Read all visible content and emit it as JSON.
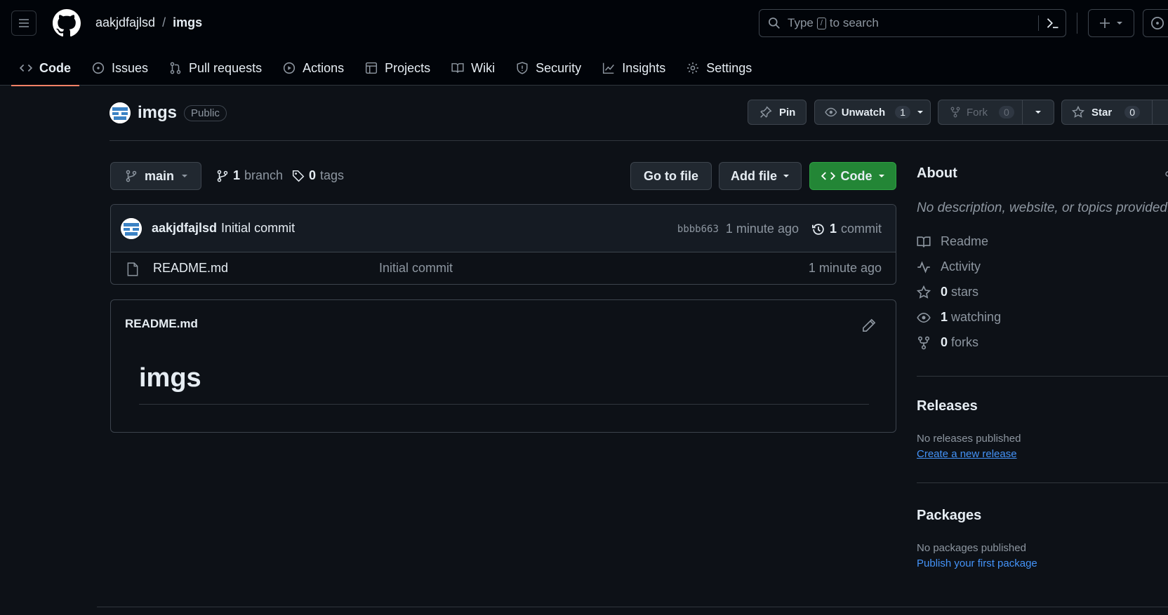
{
  "header": {
    "owner": "aakjdfajlsd",
    "separator": "/",
    "repo": "imgs",
    "search_prefix": "Type",
    "search_key": "/",
    "search_suffix": "to search"
  },
  "nav": {
    "code": "Code",
    "issues": "Issues",
    "pulls": "Pull requests",
    "actions": "Actions",
    "projects": "Projects",
    "wiki": "Wiki",
    "security": "Security",
    "insights": "Insights",
    "settings": "Settings"
  },
  "repo": {
    "name": "imgs",
    "visibility": "Public",
    "pin_label": "Pin",
    "unwatch_label": "Unwatch",
    "watch_count": "1",
    "fork_label": "Fork",
    "fork_count": "0",
    "star_label": "Star",
    "star_count": "0"
  },
  "branch": {
    "current": "main",
    "branch_count": "1",
    "branch_word": "branch",
    "tag_count": "0",
    "tag_word": "tags",
    "go_to_file": "Go to file",
    "add_file": "Add file",
    "code_button": "Code"
  },
  "commit": {
    "author": "aakjdfajlsd",
    "message": "Initial commit",
    "sha": "bbbb663",
    "time": "1 minute ago",
    "count": "1",
    "count_word": "commit"
  },
  "files": [
    {
      "name": "README.md",
      "message": "Initial commit",
      "time": "1 minute ago"
    }
  ],
  "readme": {
    "filename": "README.md",
    "heading": "imgs"
  },
  "about": {
    "title": "About",
    "description": "No description, website, or topics provided.",
    "readme": "Readme",
    "activity": "Activity",
    "stars_count": "0",
    "stars_word": "stars",
    "watching_count": "1",
    "watching_word": "watching",
    "forks_count": "0",
    "forks_word": "forks"
  },
  "releases": {
    "title": "Releases",
    "empty": "No releases published",
    "link": "Create a new release"
  },
  "packages": {
    "title": "Packages",
    "empty": "No packages published",
    "link": "Publish your first package"
  },
  "colors": {
    "accent_underline": "#f78166",
    "green_button": "#238636",
    "link": "#4493f8",
    "background": "#0d1117"
  }
}
